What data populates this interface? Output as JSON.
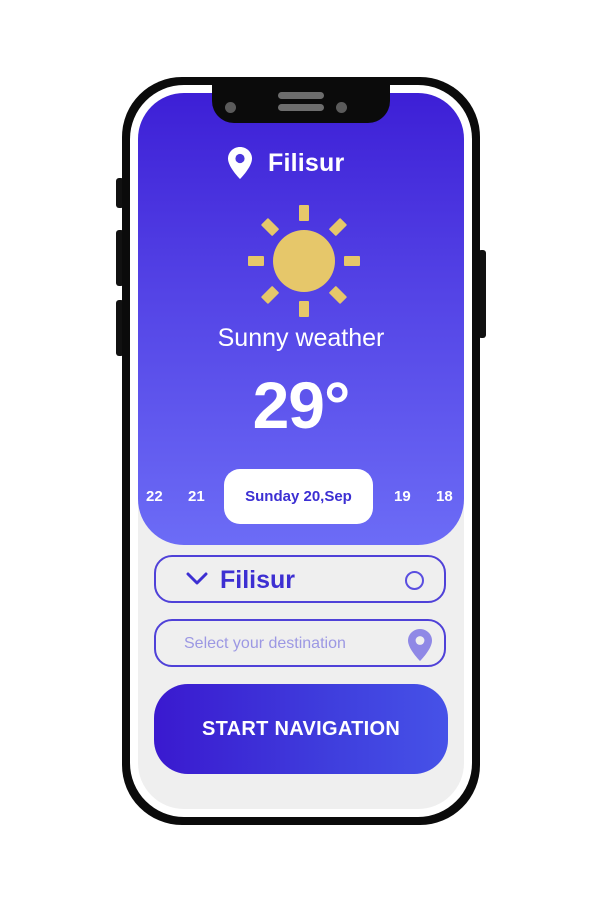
{
  "header": {
    "city": "Filisur",
    "location_icon": "location-pin-icon"
  },
  "weather": {
    "icon": "sun-icon",
    "condition": "Sunny weather",
    "temperature": "29°",
    "sun_color": "#e6c76a"
  },
  "days": {
    "items": [
      {
        "label": "22"
      },
      {
        "label": "21"
      },
      {
        "label": "Sunday 20,Sep",
        "selected": true
      },
      {
        "label": "19"
      },
      {
        "label": "18"
      }
    ]
  },
  "route": {
    "origin": "Filisur",
    "origin_icon": "chevron-down-icon",
    "destination_value": "",
    "destination_placeholder": "Select your destination",
    "destination_icon": "location-pin-icon"
  },
  "actions": {
    "start_label": "START NAVIGATION"
  },
  "colors": {
    "accent": "#3d2fd2",
    "gradient_top": "#3d1fd6",
    "gradient_bottom": "#6c6cf6",
    "background": "#efefef"
  }
}
